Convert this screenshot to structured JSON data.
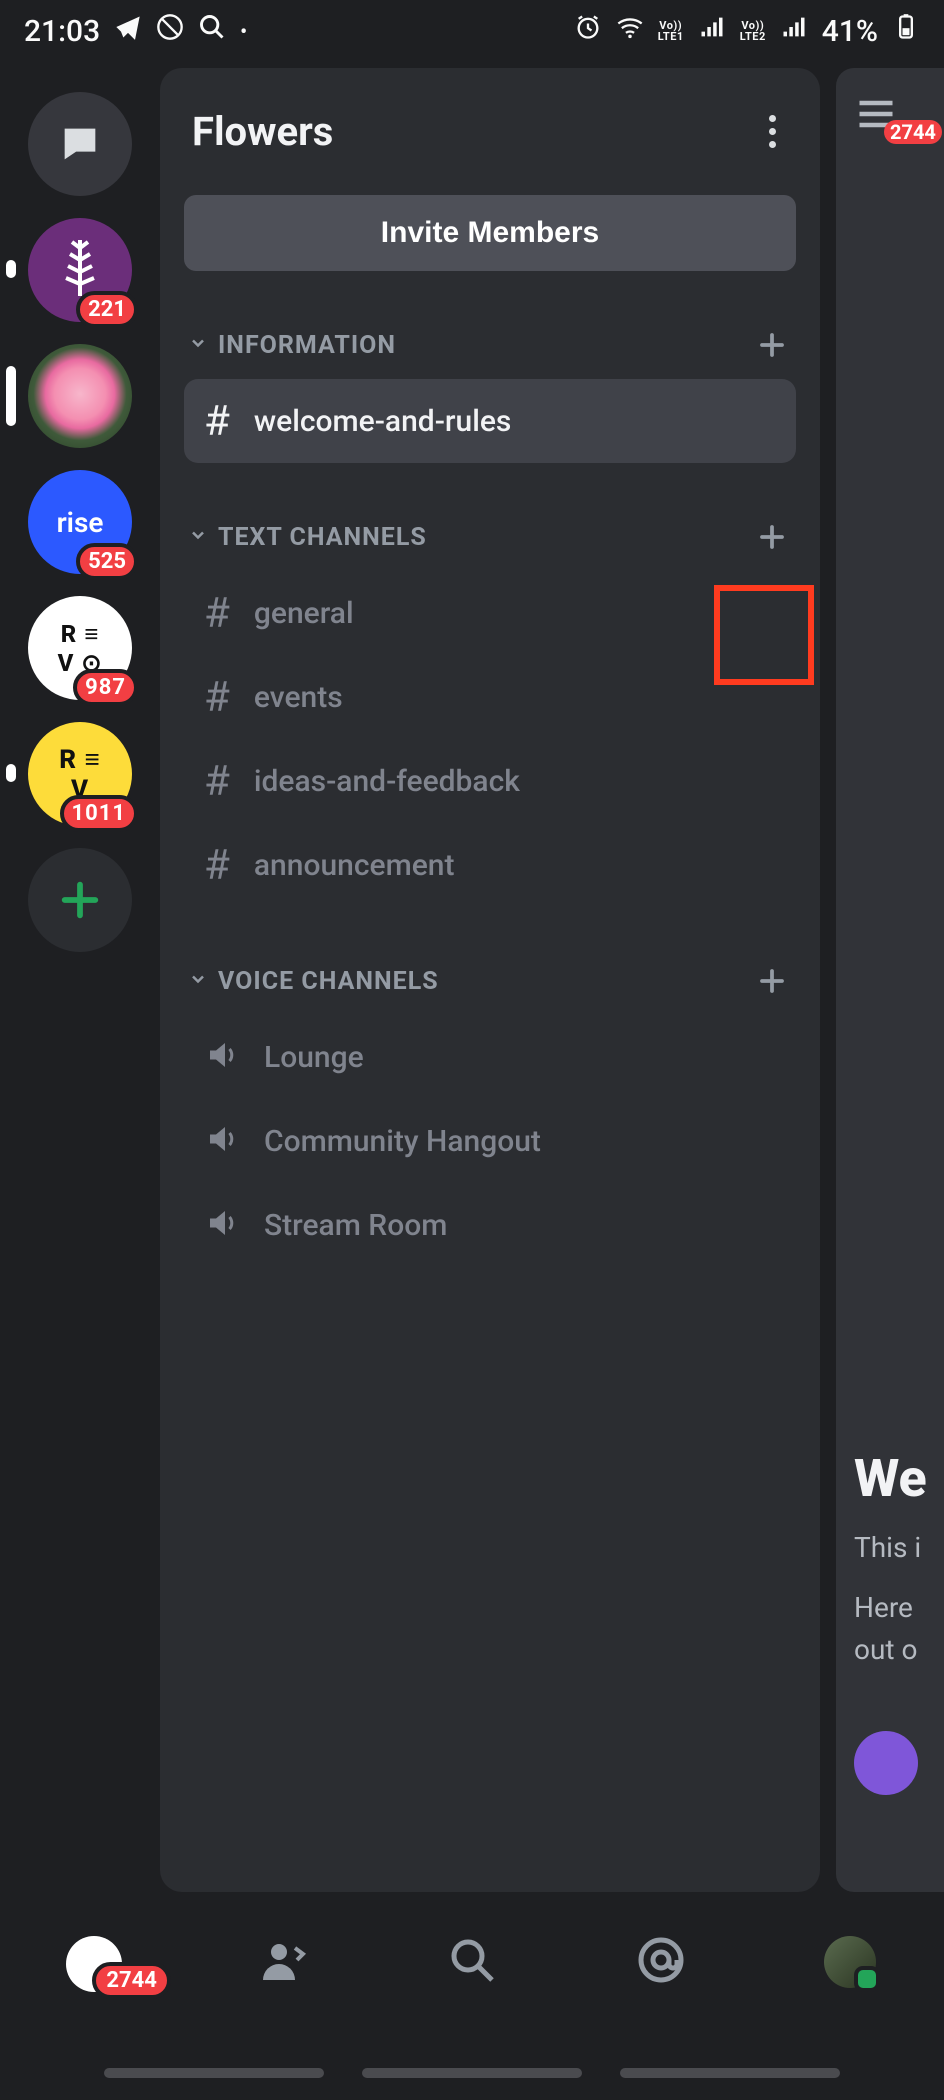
{
  "statusbar": {
    "time": "21:03",
    "battery": "41%",
    "lte1": "Vo))\nLTE1",
    "lte2": "Vo))\nLTE2"
  },
  "server": {
    "title": "Flowers",
    "invite_label": "Invite Members"
  },
  "categories": [
    {
      "name": "INFORMATION",
      "add": true,
      "channels": [
        {
          "name": "welcome-and-rules",
          "type": "text",
          "selected": true
        }
      ]
    },
    {
      "name": "TEXT CHANNELS",
      "add": true,
      "highlight_add": true,
      "channels": [
        {
          "name": "general",
          "type": "text"
        },
        {
          "name": "events",
          "type": "text"
        },
        {
          "name": "ideas-and-feedback",
          "type": "text"
        },
        {
          "name": "announcement",
          "type": "text"
        }
      ]
    },
    {
      "name": "VOICE CHANNELS",
      "add": true,
      "channels": [
        {
          "name": "Lounge",
          "type": "voice"
        },
        {
          "name": "Community Hangout",
          "type": "voice"
        },
        {
          "name": "Stream Room",
          "type": "voice"
        }
      ]
    }
  ],
  "rail": [
    {
      "id": "dm",
      "kind": "dm",
      "active": true
    },
    {
      "id": "wheat",
      "kind": "purple",
      "badge": "221",
      "pill": "short"
    },
    {
      "id": "rose",
      "kind": "photo",
      "pill": "tall"
    },
    {
      "id": "rise",
      "kind": "blue",
      "label": "rise",
      "badge": "525"
    },
    {
      "id": "revo1",
      "kind": "white",
      "label": "R ≡\nV ⊙",
      "badge": "987"
    },
    {
      "id": "revo2",
      "kind": "yellow",
      "label": "R ≡\nV",
      "badge": "1011",
      "pill": "short"
    },
    {
      "id": "add",
      "kind": "add"
    }
  ],
  "chat": {
    "menu_badge": "2744",
    "welcome_heading": "We",
    "line1": "This i",
    "line2": "Here",
    "line3": "out o"
  },
  "tabs": {
    "home_badge": "2744"
  }
}
